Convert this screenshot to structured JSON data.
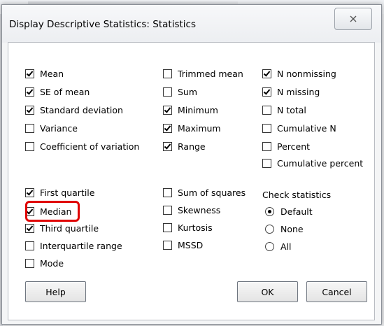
{
  "window": {
    "title": "Display Descriptive Statistics: Statistics",
    "close_icon": "close-icon"
  },
  "statistics": {
    "col1": [
      {
        "label": "Mean",
        "checked": true
      },
      {
        "label": "SE of mean",
        "checked": true
      },
      {
        "label": "Standard deviation",
        "checked": true
      },
      {
        "label": "Variance",
        "checked": false
      },
      {
        "label": "Coefficient of variation",
        "checked": false
      },
      {
        "label": "First quartile",
        "checked": true
      },
      {
        "label": "Median",
        "checked": true
      },
      {
        "label": "Third quartile",
        "checked": true
      },
      {
        "label": "Interquartile range",
        "checked": false
      },
      {
        "label": "Mode",
        "checked": false
      }
    ],
    "col2": [
      {
        "label": "Trimmed mean",
        "checked": false
      },
      {
        "label": "Sum",
        "checked": false
      },
      {
        "label": "Minimum",
        "checked": true
      },
      {
        "label": "Maximum",
        "checked": true
      },
      {
        "label": "Range",
        "checked": true
      },
      {
        "label": "Sum of squares",
        "checked": false
      },
      {
        "label": "Skewness",
        "checked": false
      },
      {
        "label": "Kurtosis",
        "checked": false
      },
      {
        "label": "MSSD",
        "checked": false
      }
    ],
    "col3": [
      {
        "label": "N nonmissing",
        "checked": true
      },
      {
        "label": "N missing",
        "checked": true
      },
      {
        "label": "N total",
        "checked": false
      },
      {
        "label": "Cumulative N",
        "checked": false
      },
      {
        "label": "Percent",
        "checked": false
      },
      {
        "label": "Cumulative percent",
        "checked": false
      }
    ]
  },
  "check_statistics": {
    "title": "Check statistics",
    "options": [
      {
        "label": "Default",
        "selected": true
      },
      {
        "label": "None",
        "selected": false
      },
      {
        "label": "All",
        "selected": false
      }
    ]
  },
  "buttons": {
    "help": "Help",
    "ok": "OK",
    "cancel": "Cancel"
  },
  "annotation": {
    "highlight_color": "#e00000",
    "highlighted_item": "Median"
  }
}
